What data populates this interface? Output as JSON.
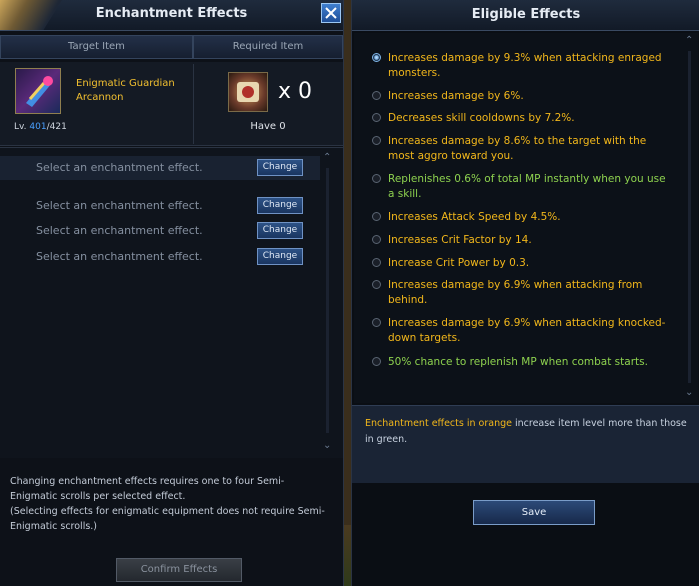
{
  "left_panel": {
    "title": "Enchantment Effects",
    "tabs": [
      "Target Item",
      "Required Item"
    ],
    "target_item": {
      "name": "Enigmatic Guardian Arcannon",
      "level_prefix": "Lv.",
      "level_current": "401",
      "level_max": "/421"
    },
    "required_item": {
      "quantity": "x 0",
      "have": "Have 0"
    },
    "enchant_slots": [
      {
        "label": "Select an enchantment effect.",
        "button": "Change"
      },
      {
        "label": "Select an enchantment effect.",
        "button": "Change"
      },
      {
        "label": "Select an enchantment effect.",
        "button": "Change"
      },
      {
        "label": "Select an enchantment effect.",
        "button": "Change"
      }
    ],
    "note_line1": "Changing enchantment effects requires one to four Semi-Enigmatic scrolls per selected effect.",
    "note_line2": "(Selecting effects for enigmatic equipment does not require Semi-Enigmatic scrolls.)",
    "confirm_label": "Confirm Effects"
  },
  "right_panel": {
    "title": "Eligible Effects",
    "effects": [
      {
        "text": "Increases damage by 9.3% when attacking enraged monsters.",
        "color": "orange",
        "selected": true
      },
      {
        "text": "Increases damage by 6%.",
        "color": "orange",
        "selected": false
      },
      {
        "text": "Decreases skill cooldowns by 7.2%.",
        "color": "orange",
        "selected": false
      },
      {
        "text": "Increases damage by 8.6% to the target with the most aggro toward you.",
        "color": "orange",
        "selected": false
      },
      {
        "text": "Replenishes 0.6% of total MP instantly when you use a skill.",
        "color": "green",
        "selected": false
      },
      {
        "text": "Increases Attack Speed by 4.5%.",
        "color": "orange",
        "selected": false
      },
      {
        "text": "Increases Crit Factor by 14.",
        "color": "orange",
        "selected": false
      },
      {
        "text": "Increase Crit Power by 0.3.",
        "color": "orange",
        "selected": false
      },
      {
        "text": "Increases damage by 6.9% when attacking from behind.",
        "color": "orange",
        "selected": false
      },
      {
        "text": "Increases damage by 6.9% when attacking knocked-down targets.",
        "color": "orange",
        "selected": false
      },
      {
        "text": "50% chance to replenish MP when combat starts.",
        "color": "green",
        "selected": false
      }
    ],
    "info_highlight": "Enchantment effects in orange",
    "info_rest": " increase item level more than those in green.",
    "save_label": "Save"
  },
  "colors": {
    "orange": "#f2b71b",
    "green": "#8ed24f",
    "level_blue": "#4aa0ff"
  }
}
